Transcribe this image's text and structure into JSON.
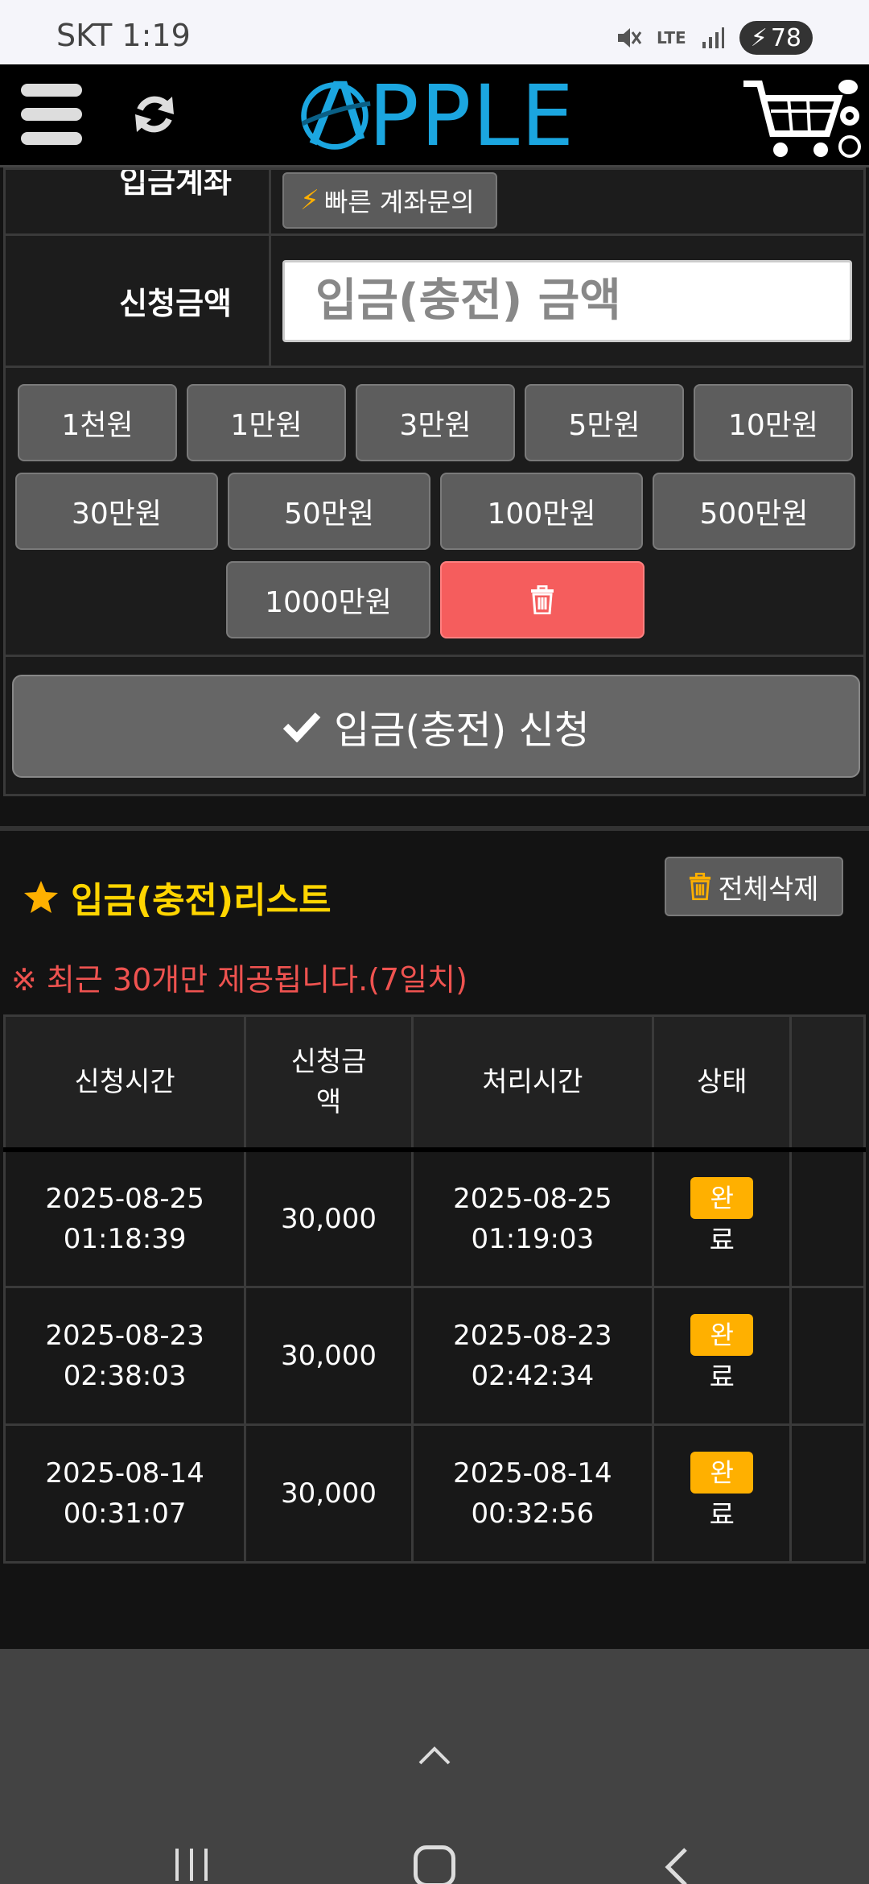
{
  "status": {
    "carrier": "SKT",
    "time": "1:19",
    "network": "LTE",
    "battery": "78"
  },
  "header": {
    "logo_text": "PPLE"
  },
  "form": {
    "account_label": "입금계좌",
    "quick_inquiry_label": "빠른 계좌문의",
    "amount_label": "신청금액",
    "amount_placeholder": "입금(충전) 금액",
    "amount_buttons_row1": [
      "1천원",
      "1만원",
      "3만원",
      "5만원",
      "10만원"
    ],
    "amount_buttons_row2": [
      "30만원",
      "50만원",
      "100만원",
      "500만원"
    ],
    "amount_buttons_row3": [
      "1000만원"
    ],
    "submit_label": "입금(충전) 신청"
  },
  "list": {
    "title": "입금(충전)리스트",
    "delete_all_label": "전체삭제",
    "notice": "※ 최근 30개만 제공됩니다.(7일치)",
    "columns": [
      "신청시간",
      "신청금\n액",
      "처리시간",
      "상태",
      ""
    ],
    "rows": [
      {
        "req_date": "2025-08-25",
        "req_time": "01:18:39",
        "amount": "30,000",
        "proc_date": "2025-08-25",
        "proc_time": "01:19:03",
        "status_a": "완",
        "status_b": "료"
      },
      {
        "req_date": "2025-08-23",
        "req_time": "02:38:03",
        "amount": "30,000",
        "proc_date": "2025-08-23",
        "proc_time": "02:42:34",
        "status_a": "완",
        "status_b": "료"
      },
      {
        "req_date": "2025-08-14",
        "req_time": "00:31:07",
        "amount": "30,000",
        "proc_date": "2025-08-14",
        "proc_time": "00:32:56",
        "status_a": "완",
        "status_b": "료"
      }
    ]
  },
  "colors": {
    "accent_blue": "#1ba6e0",
    "title_yellow": "#ffd500",
    "notice_red": "#ef5350",
    "trash_red": "#f55d5d",
    "badge_orange": "#ffb000"
  }
}
